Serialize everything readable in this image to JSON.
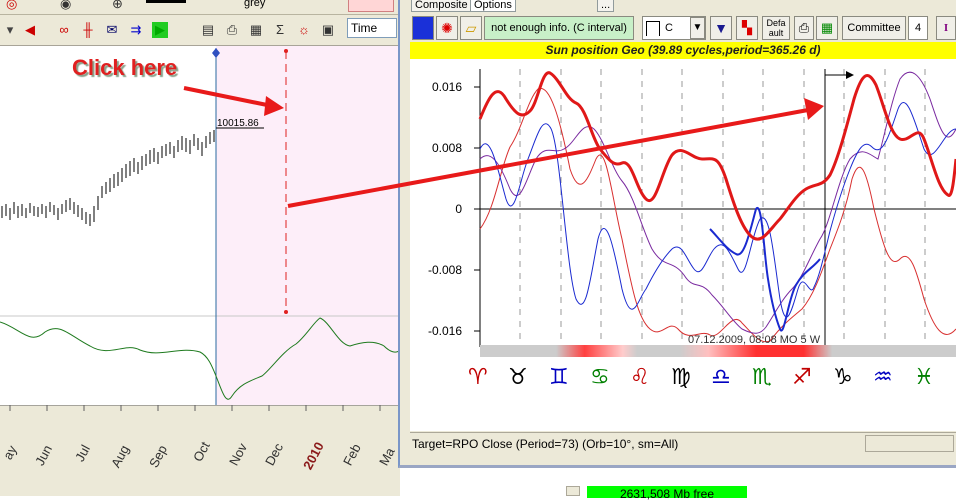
{
  "background_app": {
    "top_label": "grey",
    "time_dropdown": "Time",
    "price_label": "10015.86",
    "months": [
      "ay",
      "Jun",
      "Jul",
      "Aug",
      "Sep",
      "Oct",
      "Nov",
      "Dec",
      "2010",
      "Feb",
      "Ma"
    ],
    "year_color": "#8b1a1a"
  },
  "annotation": {
    "text": "Click here",
    "arrow_color": "#e81a1a"
  },
  "popup": {
    "tabs": [
      "Composite",
      "Options"
    ],
    "ellipsis": "...",
    "toolbar": {
      "info_button": "not enough info. (C interval)",
      "combo_value": "C",
      "default_button": "Defa ault",
      "committee_button": "Committee",
      "spinner_value": "4",
      "italic_button": "I"
    },
    "title": "Sun position Geo  (39.89 cycles,period=365.26 d)",
    "y_ticks": [
      "0.016",
      "0.008",
      "0",
      "-0.008",
      "-0.016"
    ],
    "cursor_label": "07.12.2009, 08:08 MO  5 W",
    "zodiac": [
      {
        "sign": "♈",
        "color": "#c00000"
      },
      {
        "sign": "♉",
        "color": "#000000"
      },
      {
        "sign": "♊",
        "color": "#0000c0"
      },
      {
        "sign": "♋",
        "color": "#008000"
      },
      {
        "sign": "♌",
        "color": "#c00000"
      },
      {
        "sign": "♍",
        "color": "#000000"
      },
      {
        "sign": "♎",
        "color": "#0000c0"
      },
      {
        "sign": "♏",
        "color": "#008000"
      },
      {
        "sign": "♐",
        "color": "#c00000"
      },
      {
        "sign": "♑",
        "color": "#000000"
      },
      {
        "sign": "♒",
        "color": "#0000c0"
      },
      {
        "sign": "♓",
        "color": "#008000"
      }
    ],
    "status": "Target=RPO Close (Period=73) (Orb=10°, sm=All)"
  },
  "footer": {
    "free_memory": "2631,508 Mb free"
  }
}
